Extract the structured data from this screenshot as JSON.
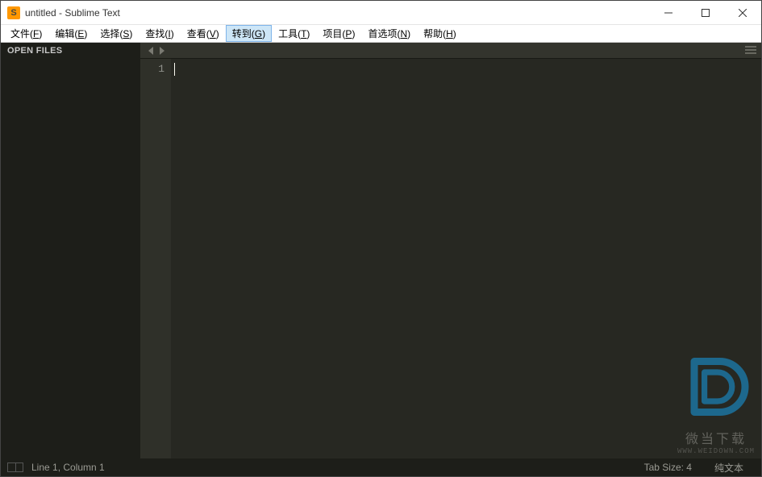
{
  "title": "untitled - Sublime Text",
  "appIconLetter": "S",
  "menu": {
    "file": {
      "label": "文件(",
      "hot": "F",
      "tail": ")"
    },
    "edit": {
      "label": "编辑(",
      "hot": "E",
      "tail": ")"
    },
    "select": {
      "label": "选择(",
      "hot": "S",
      "tail": ")"
    },
    "find": {
      "label": "查找(",
      "hot": "I",
      "tail": ")"
    },
    "view": {
      "label": "查看(",
      "hot": "V",
      "tail": ")"
    },
    "goto": {
      "label": "转到(",
      "hot": "G",
      "tail": ")"
    },
    "tools": {
      "label": "工具(",
      "hot": "T",
      "tail": ")"
    },
    "project": {
      "label": "项目(",
      "hot": "P",
      "tail": ")"
    },
    "prefs": {
      "label": "首选项(",
      "hot": "N",
      "tail": ")"
    },
    "help": {
      "label": "帮助(",
      "hot": "H",
      "tail": ")"
    }
  },
  "sidebar": {
    "header": "OPEN FILES"
  },
  "gutter": {
    "line1": "1"
  },
  "status": {
    "position": "Line 1, Column 1",
    "tabSize": "Tab Size: 4",
    "syntax": "纯文本"
  },
  "watermark": {
    "title": "微当下载",
    "sub": "WWW.WEIDOWN.COM"
  }
}
